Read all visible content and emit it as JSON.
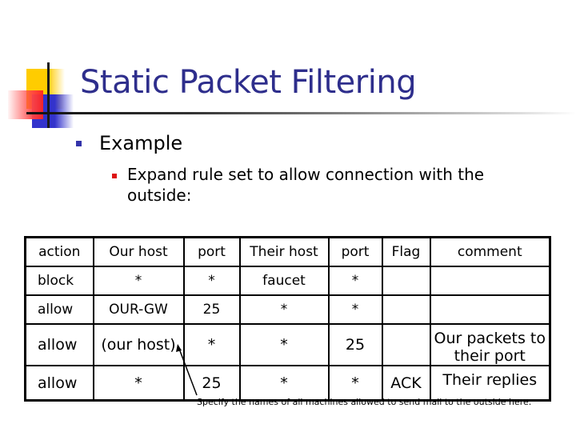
{
  "slide": {
    "title": "Static Packet Filtering",
    "bullets": [
      {
        "level": 1,
        "text": "Example",
        "bullet_color": "#3333aa"
      },
      {
        "level": 2,
        "text": "Expand rule set to allow connection with the outside:",
        "bullet_color": "#dd1111"
      }
    ],
    "title_color": "#2e2e8c"
  },
  "table": {
    "headers": [
      "action",
      "Our host",
      "port",
      "Their host",
      "port",
      "Flag",
      "comment"
    ],
    "rows": [
      [
        "block",
        "*",
        "*",
        "faucet",
        "*",
        "",
        ""
      ],
      [
        "allow",
        "OUR-GW",
        "25",
        "*",
        "*",
        "",
        ""
      ],
      [
        "allow",
        "(our host)",
        "*",
        "*",
        "25",
        "",
        "Our packets to their port"
      ],
      [
        "allow",
        "*",
        "25",
        "*",
        "*",
        "ACK",
        "Their replies"
      ]
    ]
  },
  "annotation": {
    "text": "Specify the names of all machines allowed to send mail to the outside here.",
    "points_to": "(our host)"
  }
}
